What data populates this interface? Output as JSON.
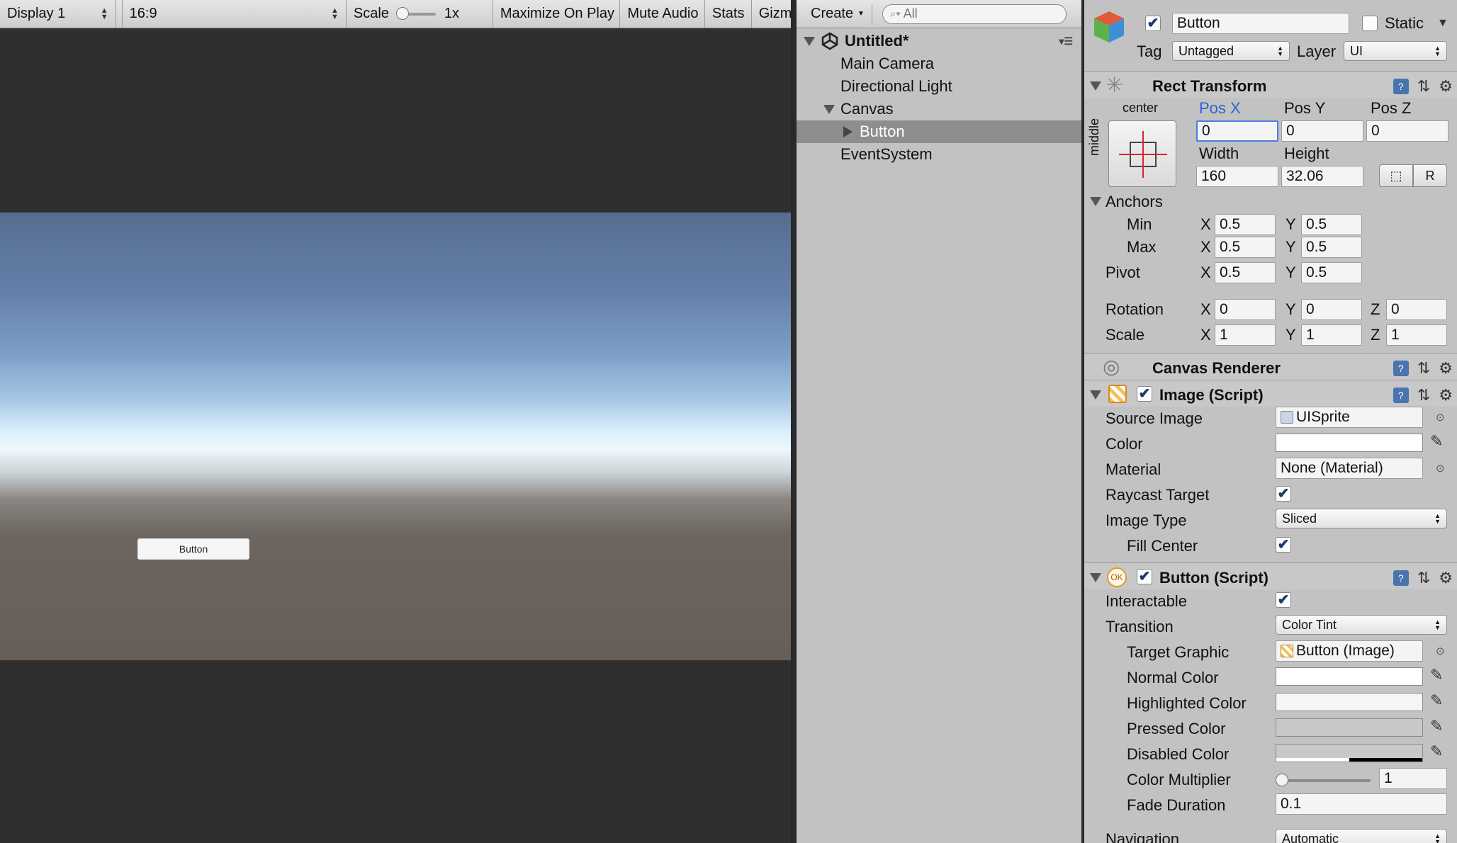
{
  "game_view": {
    "display": "Display 1",
    "aspect": "16:9",
    "scale_label": "Scale",
    "scale_value": "1x",
    "maximize_on_play": "Maximize On Play",
    "mute_audio": "Mute Audio",
    "stats": "Stats",
    "gizmos": "Gizmos",
    "scene_button_text": "Button"
  },
  "hierarchy": {
    "create": "Create",
    "search_placeholder": "All",
    "scene_name": "Untitled*",
    "items": [
      {
        "label": "Main Camera"
      },
      {
        "label": "Directional Light"
      },
      {
        "label": "Canvas"
      },
      {
        "label": "Button"
      },
      {
        "label": "EventSystem"
      }
    ]
  },
  "inspector": {
    "object_name": "Button",
    "static_label": "Static",
    "tag_label": "Tag",
    "tag_value": "Untagged",
    "layer_label": "Layer",
    "layer_value": "UI",
    "rect_transform": {
      "title": "Rect Transform",
      "anchor_preset_h": "center",
      "anchor_preset_v": "middle",
      "pos_x_label": "Pos X",
      "pos_x": "0",
      "pos_y_label": "Pos Y",
      "pos_y": "0",
      "pos_z_label": "Pos Z",
      "pos_z": "0",
      "width_label": "Width",
      "width": "160",
      "height_label": "Height",
      "height": "32.06",
      "raw_edit_label": "R",
      "anchors_label": "Anchors",
      "min_label": "Min",
      "min_x": "0.5",
      "min_y": "0.5",
      "max_label": "Max",
      "max_x": "0.5",
      "max_y": "0.5",
      "pivot_label": "Pivot",
      "pivot_x": "0.5",
      "pivot_y": "0.5",
      "rotation_label": "Rotation",
      "rot_x": "0",
      "rot_y": "0",
      "rot_z": "0",
      "scale_label": "Scale",
      "scale_x": "1",
      "scale_y": "1",
      "scale_z": "1",
      "x_label": "X",
      "y_label": "Y",
      "z_label": "Z"
    },
    "canvas_renderer": {
      "title": "Canvas Renderer"
    },
    "image_script": {
      "title": "Image (Script)",
      "source_image_label": "Source Image",
      "source_image": "UISprite",
      "color_label": "Color",
      "material_label": "Material",
      "material": "None (Material)",
      "raycast_label": "Raycast Target",
      "image_type_label": "Image Type",
      "image_type": "Sliced",
      "fill_center_label": "Fill Center"
    },
    "button_script": {
      "title": "Button (Script)",
      "badge": "OK",
      "interactable_label": "Interactable",
      "transition_label": "Transition",
      "transition": "Color Tint",
      "target_graphic_label": "Target Graphic",
      "target_graphic": "Button (Image)",
      "normal_color_label": "Normal Color",
      "highlighted_color_label": "Highlighted Color",
      "pressed_color_label": "Pressed Color",
      "disabled_color_label": "Disabled Color",
      "color_multiplier_label": "Color Multiplier",
      "color_multiplier": "1",
      "fade_duration_label": "Fade Duration",
      "fade_duration": "0.1",
      "navigation_label": "Navigation",
      "navigation": "Automatic"
    }
  },
  "colors": {
    "panel_bg": "#c2c2c2",
    "selection": "#8e8e8e",
    "active_field": "#4a7de0",
    "pos_x_label": "#2e63d8"
  }
}
